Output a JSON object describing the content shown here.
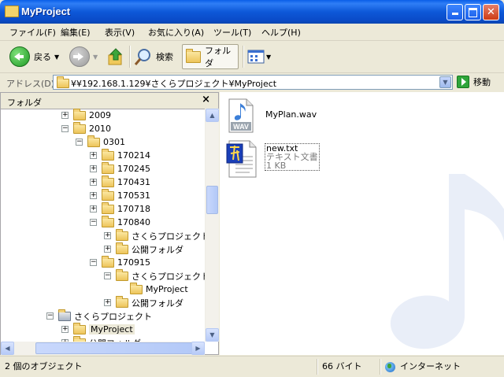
{
  "window": {
    "title": "MyProject"
  },
  "menu": [
    "ファイル(F)",
    "編集(E)",
    "表示(V)",
    "お気に入り(A)",
    "ツール(T)",
    "ヘルプ(H)"
  ],
  "toolbar": {
    "back_label": "戻る",
    "search_label": "検索",
    "folders_label": "フォルダ"
  },
  "address": {
    "label": "アドレス(D)",
    "path": "¥¥192.168.1.129¥さくらプロジェクト¥MyProject",
    "go_label": "移動"
  },
  "folderpane": {
    "title": "フォルダ",
    "close": "×",
    "tree": [
      {
        "label": "2009",
        "depth": 0,
        "toggle": "+"
      },
      {
        "label": "2010",
        "depth": 0,
        "toggle": "−"
      },
      {
        "label": "0301",
        "depth": 1,
        "toggle": "−"
      },
      {
        "label": "170214",
        "depth": 2,
        "toggle": "+"
      },
      {
        "label": "170245",
        "depth": 2,
        "toggle": "+"
      },
      {
        "label": "170431",
        "depth": 2,
        "toggle": "+"
      },
      {
        "label": "170531",
        "depth": 2,
        "toggle": "+"
      },
      {
        "label": "170718",
        "depth": 2,
        "toggle": "+"
      },
      {
        "label": "170840",
        "depth": 2,
        "toggle": "−"
      },
      {
        "label": "さくらプロジェクト",
        "depth": 3,
        "toggle": "+"
      },
      {
        "label": "公開フォルダ",
        "depth": 3,
        "toggle": "+"
      },
      {
        "label": "170915",
        "depth": 2,
        "toggle": "−"
      },
      {
        "label": "さくらプロジェクト",
        "depth": 3,
        "toggle": "−"
      },
      {
        "label": "MyProject",
        "depth": 4,
        "toggle": ""
      },
      {
        "label": "公開フォルダ",
        "depth": 3,
        "toggle": "+"
      },
      {
        "label": "さくらプロジェクト",
        "depth": -1,
        "toggle": "−"
      },
      {
        "label": "MyProject",
        "depth": 0,
        "toggle": "+",
        "selected": true
      },
      {
        "label": "公開フォルダ",
        "depth": 0,
        "toggle": "+"
      }
    ]
  },
  "files": [
    {
      "name": "MyPlan.wav",
      "type_badge": "WAV"
    },
    {
      "name": "new.txt",
      "type": "テキスト文書",
      "size": "1 KB"
    }
  ],
  "status": {
    "objects": "2 個のオブジェクト",
    "size": "66 バイト",
    "zone": "インターネット"
  },
  "colors": {
    "titlebar": "#0A5EE8",
    "selection": "#ECE9D8",
    "accent_green": "#2FA53A"
  }
}
